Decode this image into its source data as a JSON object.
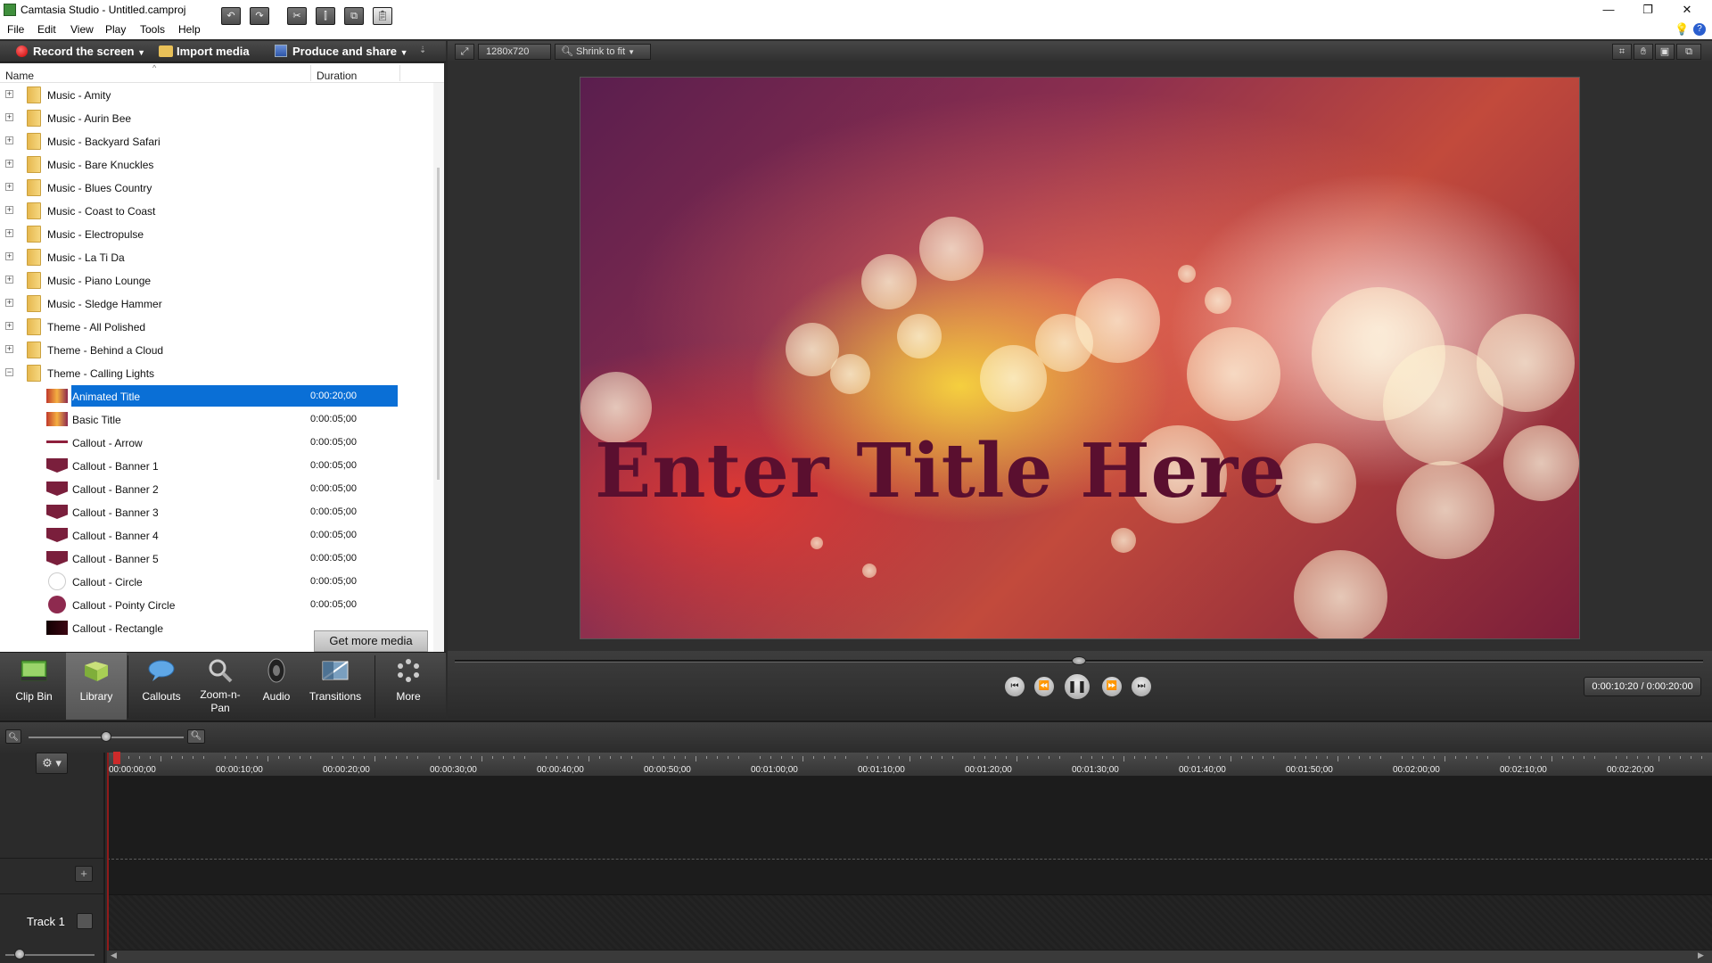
{
  "window": {
    "title": "Camtasia Studio - Untitled.camproj",
    "minimize": "—",
    "maximize": "❐",
    "close": "✕"
  },
  "menu": [
    "File",
    "Edit",
    "View",
    "Play",
    "Tools",
    "Help"
  ],
  "toolbar": {
    "record": "Record the screen",
    "import": "Import media",
    "produce": "Produce and share"
  },
  "library": {
    "col_name": "Name",
    "col_duration": "Duration",
    "folders": [
      "Music - Amity",
      "Music - Aurin Bee",
      "Music - Backyard Safari",
      "Music - Bare Knuckles",
      "Music - Blues Country",
      "Music - Coast to Coast",
      "Music - Electropulse",
      "Music - La Ti Da",
      "Music - Piano Lounge",
      "Music - Sledge Hammer",
      "Theme - All Polished",
      "Theme - Behind a Cloud",
      "Theme - Calling Lights"
    ],
    "items": [
      {
        "name": "Animated Title",
        "duration": "0:00:20;00",
        "selected": true,
        "thumb": "bokeh-thumb"
      },
      {
        "name": "Basic Title",
        "duration": "0:00:05;00",
        "selected": false,
        "thumb": "bokeh-thumb"
      },
      {
        "name": "Callout - Arrow",
        "duration": "0:00:05;00",
        "selected": false,
        "thumb": "arrow-thumb"
      },
      {
        "name": "Callout - Banner 1",
        "duration": "0:00:05;00",
        "selected": false,
        "thumb": "banner-thumb"
      },
      {
        "name": "Callout - Banner 2",
        "duration": "0:00:05;00",
        "selected": false,
        "thumb": "banner-thumb"
      },
      {
        "name": "Callout - Banner 3",
        "duration": "0:00:05;00",
        "selected": false,
        "thumb": "banner-thumb"
      },
      {
        "name": "Callout - Banner 4",
        "duration": "0:00:05;00",
        "selected": false,
        "thumb": "banner-thumb"
      },
      {
        "name": "Callout - Banner 5",
        "duration": "0:00:05;00",
        "selected": false,
        "thumb": "banner-thumb"
      },
      {
        "name": "Callout - Circle",
        "duration": "0:00:05;00",
        "selected": false,
        "thumb": "circle-thumb"
      },
      {
        "name": "Callout - Pointy Circle",
        "duration": "0:00:05;00",
        "selected": false,
        "thumb": "circle-thumb"
      },
      {
        "name": "Callout - Rectangle",
        "duration": "",
        "selected": false,
        "thumb": "rect-thumb"
      }
    ],
    "get_more": "Get more media"
  },
  "tabs": [
    {
      "label": "Clip Bin",
      "icon": "film-icon",
      "active": false
    },
    {
      "label": "Library",
      "icon": "library-icon",
      "active": true
    },
    {
      "label": "Callouts",
      "icon": "callout-icon",
      "active": false
    },
    {
      "label": "Zoom-n-\nPan",
      "icon": "magnifier-icon",
      "active": false
    },
    {
      "label": "Audio",
      "icon": "speaker-icon",
      "active": false
    },
    {
      "label": "Transitions",
      "icon": "transitions-icon",
      "active": false
    },
    {
      "label": "More",
      "icon": "more-icon",
      "active": false
    }
  ],
  "preview": {
    "resolution": "1280x720",
    "fit": "Shrink to fit",
    "title_text": "Enter Title Here",
    "time": "0:00:10:20 / 0:00:20:00",
    "progress_fraction": 0.5
  },
  "timeline": {
    "ticks": [
      "00:00:00;00",
      "00:00:10;00",
      "00:00:20;00",
      "00:00:30;00",
      "00:00:40;00",
      "00:00:50;00",
      "00:01:00;00",
      "00:01:10;00",
      "00:01:20;00",
      "00:01:30;00",
      "00:01:40;00",
      "00:01:50;00",
      "00:02:00;00",
      "00:02:10;00",
      "00:02:20;00"
    ],
    "track_label": "Track 1"
  },
  "colors": {
    "accent_selection": "#0a6fd6",
    "title_color": "#5a0f2f",
    "record_dot": "#d40000"
  }
}
